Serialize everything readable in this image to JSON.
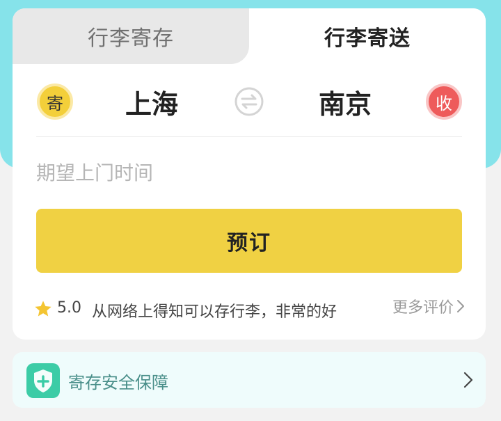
{
  "tabs": {
    "storage": "行李寄存",
    "delivery": "行李寄送"
  },
  "route": {
    "send_badge": "寄",
    "from_city": "上海",
    "to_city": "南京",
    "receive_badge": "收"
  },
  "form": {
    "time_placeholder": "期望上门时间",
    "book_label": "预订"
  },
  "review": {
    "rating": "5.0",
    "text": "从网络上得知可以存行李，非常的好",
    "more_label": "更多评价"
  },
  "guarantee": {
    "label": "寄存安全保障"
  },
  "icons": {
    "star": "star-icon",
    "swap": "swap-icon",
    "shield": "shield-plus-icon",
    "chevron": "chevron-right-icon"
  },
  "colors": {
    "header_bg": "#86e3ea",
    "book_button": "#f0d143",
    "send_badge": "#f3cf3a",
    "receive_badge": "#ee5b5b",
    "shield": "#3ccca6",
    "star": "#f4c532"
  }
}
